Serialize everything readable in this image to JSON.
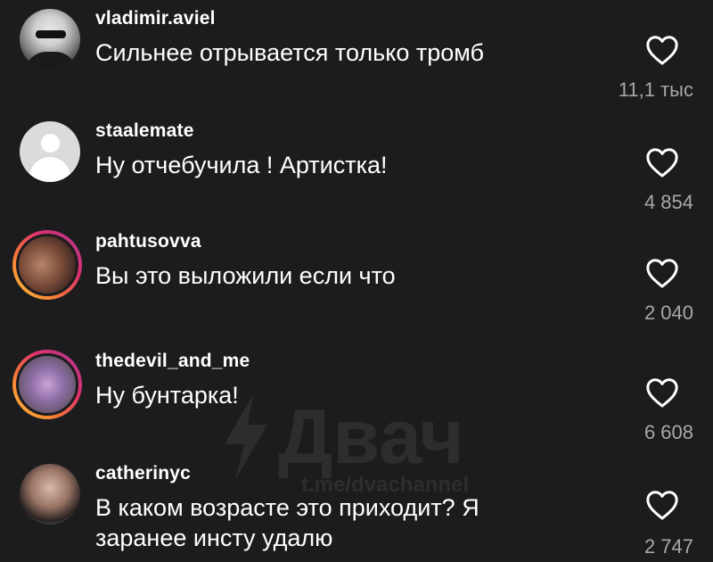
{
  "comments": [
    {
      "username": "vladimir.aviel",
      "text": "Сильнее отрывается только тромб",
      "likes": "11,1 тыс",
      "avatar": "photo-avatar",
      "story_ring": false
    },
    {
      "username": "staalemate",
      "text": "Ну отчебучила ! Артистка!",
      "likes": "4 854",
      "avatar": "default-avatar",
      "story_ring": false
    },
    {
      "username": "pahtusovva",
      "text": "Вы это выложили если что",
      "likes": "2 040",
      "avatar": "photo-avatar",
      "story_ring": true
    },
    {
      "username": "thedevil_and_me",
      "text": "Ну бунтарка!",
      "likes": "6 608",
      "avatar": "photo-avatar",
      "story_ring": true
    },
    {
      "username": "catherinyc",
      "text": "В каком возрасте это приходит? Я заранее инсту удалю",
      "likes": "2 747",
      "avatar": "photo-avatar",
      "story_ring": false
    }
  ],
  "watermark": {
    "brand": "Двач",
    "url": "t.me/dvachannel"
  },
  "colors": {
    "background": "#1c1c1e",
    "text": "#ffffff",
    "secondary_text": "#a8a8a8",
    "heart_stroke": "#ffffff"
  },
  "icons": {
    "like": "heart-outline-icon",
    "watermark_logo": "lightning-bolt-icon"
  }
}
